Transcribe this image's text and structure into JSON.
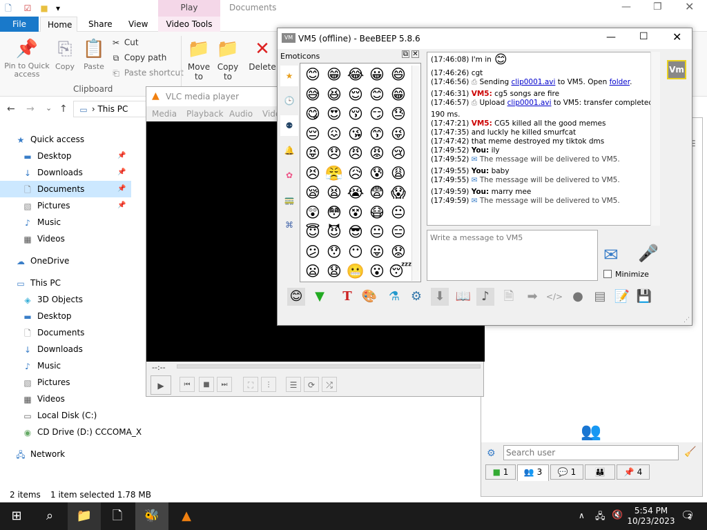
{
  "explorer": {
    "title": "Documents",
    "tabs": [
      "File",
      "Home",
      "Share",
      "View",
      "Video Tools"
    ],
    "play_tab": "Play",
    "clipboard": {
      "pin": "Pin to Quick access",
      "copy": "Copy",
      "paste": "Paste",
      "cut": "Cut",
      "copy_path": "Copy path",
      "paste_shortcut": "Paste shortcut",
      "group": "Clipboard"
    },
    "organize": {
      "move": "Move to",
      "copy_to": "Copy to",
      "delete": "Delete"
    },
    "address": "This PC",
    "nav": {
      "quick_access": "Quick access",
      "qa_items": [
        "Desktop",
        "Downloads",
        "Documents",
        "Pictures",
        "Music",
        "Videos"
      ],
      "onedrive": "OneDrive",
      "this_pc": "This PC",
      "pc_items": [
        "3D Objects",
        "Desktop",
        "Documents",
        "Downloads",
        "Music",
        "Pictures",
        "Videos",
        "Local Disk (C:)",
        "CD Drive (D:) CCCOMA_X"
      ],
      "network": "Network"
    },
    "status": {
      "items": "2 items",
      "selected": "1 item selected  1.78 MB"
    }
  },
  "vlc": {
    "title": "VLC media player",
    "menu": [
      "Media",
      "Playback",
      "Audio",
      "Video"
    ],
    "time": "--:--"
  },
  "chat": {
    "title": "VM5 (offline) - BeeBEEP 5.8.6",
    "emoticons_label": "Emoticons",
    "emojis": [
      "😊",
      "😁",
      "😂",
      "😀",
      "😄",
      "😅",
      "😆",
      "😌",
      "😊",
      "😁",
      "😋",
      "😍",
      "😚",
      "😏",
      "😓",
      "😔",
      "😖",
      "😘",
      "😙",
      "😜",
      "😝",
      "😞",
      "😠",
      "😡",
      "😢",
      "😣",
      "😤",
      "😥",
      "😰",
      "😩",
      "😪",
      "😫",
      "😭",
      "😨",
      "😱",
      "😲",
      "😳",
      "😵",
      "😷",
      "😐",
      "😇",
      "😈",
      "😎",
      "😐",
      "😑",
      "😕",
      "😯",
      "😶",
      "😛",
      "😟",
      "😦",
      "😧",
      "😬",
      "😮",
      "😴"
    ],
    "messages": [
      {
        "time": "(17:46:08)",
        "text": "I'm in"
      },
      {
        "time": "(17:46:26)",
        "text": "cgt"
      },
      {
        "time": "(17:46:56)",
        "pre": "Sending ",
        "link": "clip0001.avi",
        "post": " to VM5. Open ",
        "link2": "folder",
        "end": "."
      },
      {
        "time": "(17:46:31)",
        "sender": "VM5:",
        "text": "cg5 songs are fire"
      },
      {
        "time": "(17:46:57)",
        "pre": "Upload ",
        "link": "clip0001.avi",
        "post": " to VM5: transfer completed in"
      },
      {
        "time": "",
        "text": "190 ms."
      },
      {
        "time": "(17:47:21)",
        "sender": "VM5:",
        "text": "CG5 killed all the good memes"
      },
      {
        "time": "(17:47:35)",
        "text": "and luckly he killed smurfcat"
      },
      {
        "time": "(17:47:42)",
        "text": "that meme destroyed my tiktok dms"
      },
      {
        "time": "(17:49:52)",
        "you": "You:",
        "text": "ily"
      },
      {
        "time": "(17:49:52)",
        "sys": "The message will be delivered to VM5."
      },
      {
        "time": "(17:49:55)",
        "you": "You:",
        "text": "baby"
      },
      {
        "time": "(17:49:55)",
        "sys": "The message will be delivered to VM5."
      },
      {
        "time": "(17:49:59)",
        "you": "You:",
        "text": "marry mee"
      },
      {
        "time": "(17:49:59)",
        "sys": "The message will be delivered to VM5."
      }
    ],
    "compose_placeholder": "Write a message to VM5",
    "minimize": "Minimize"
  },
  "side": {
    "search_placeholder": "Search user",
    "tabs": [
      "1",
      "3",
      "1",
      "",
      "4"
    ]
  },
  "taskbar": {
    "time": "5:54 PM",
    "date": "10/23/2023",
    "notif": "2"
  }
}
